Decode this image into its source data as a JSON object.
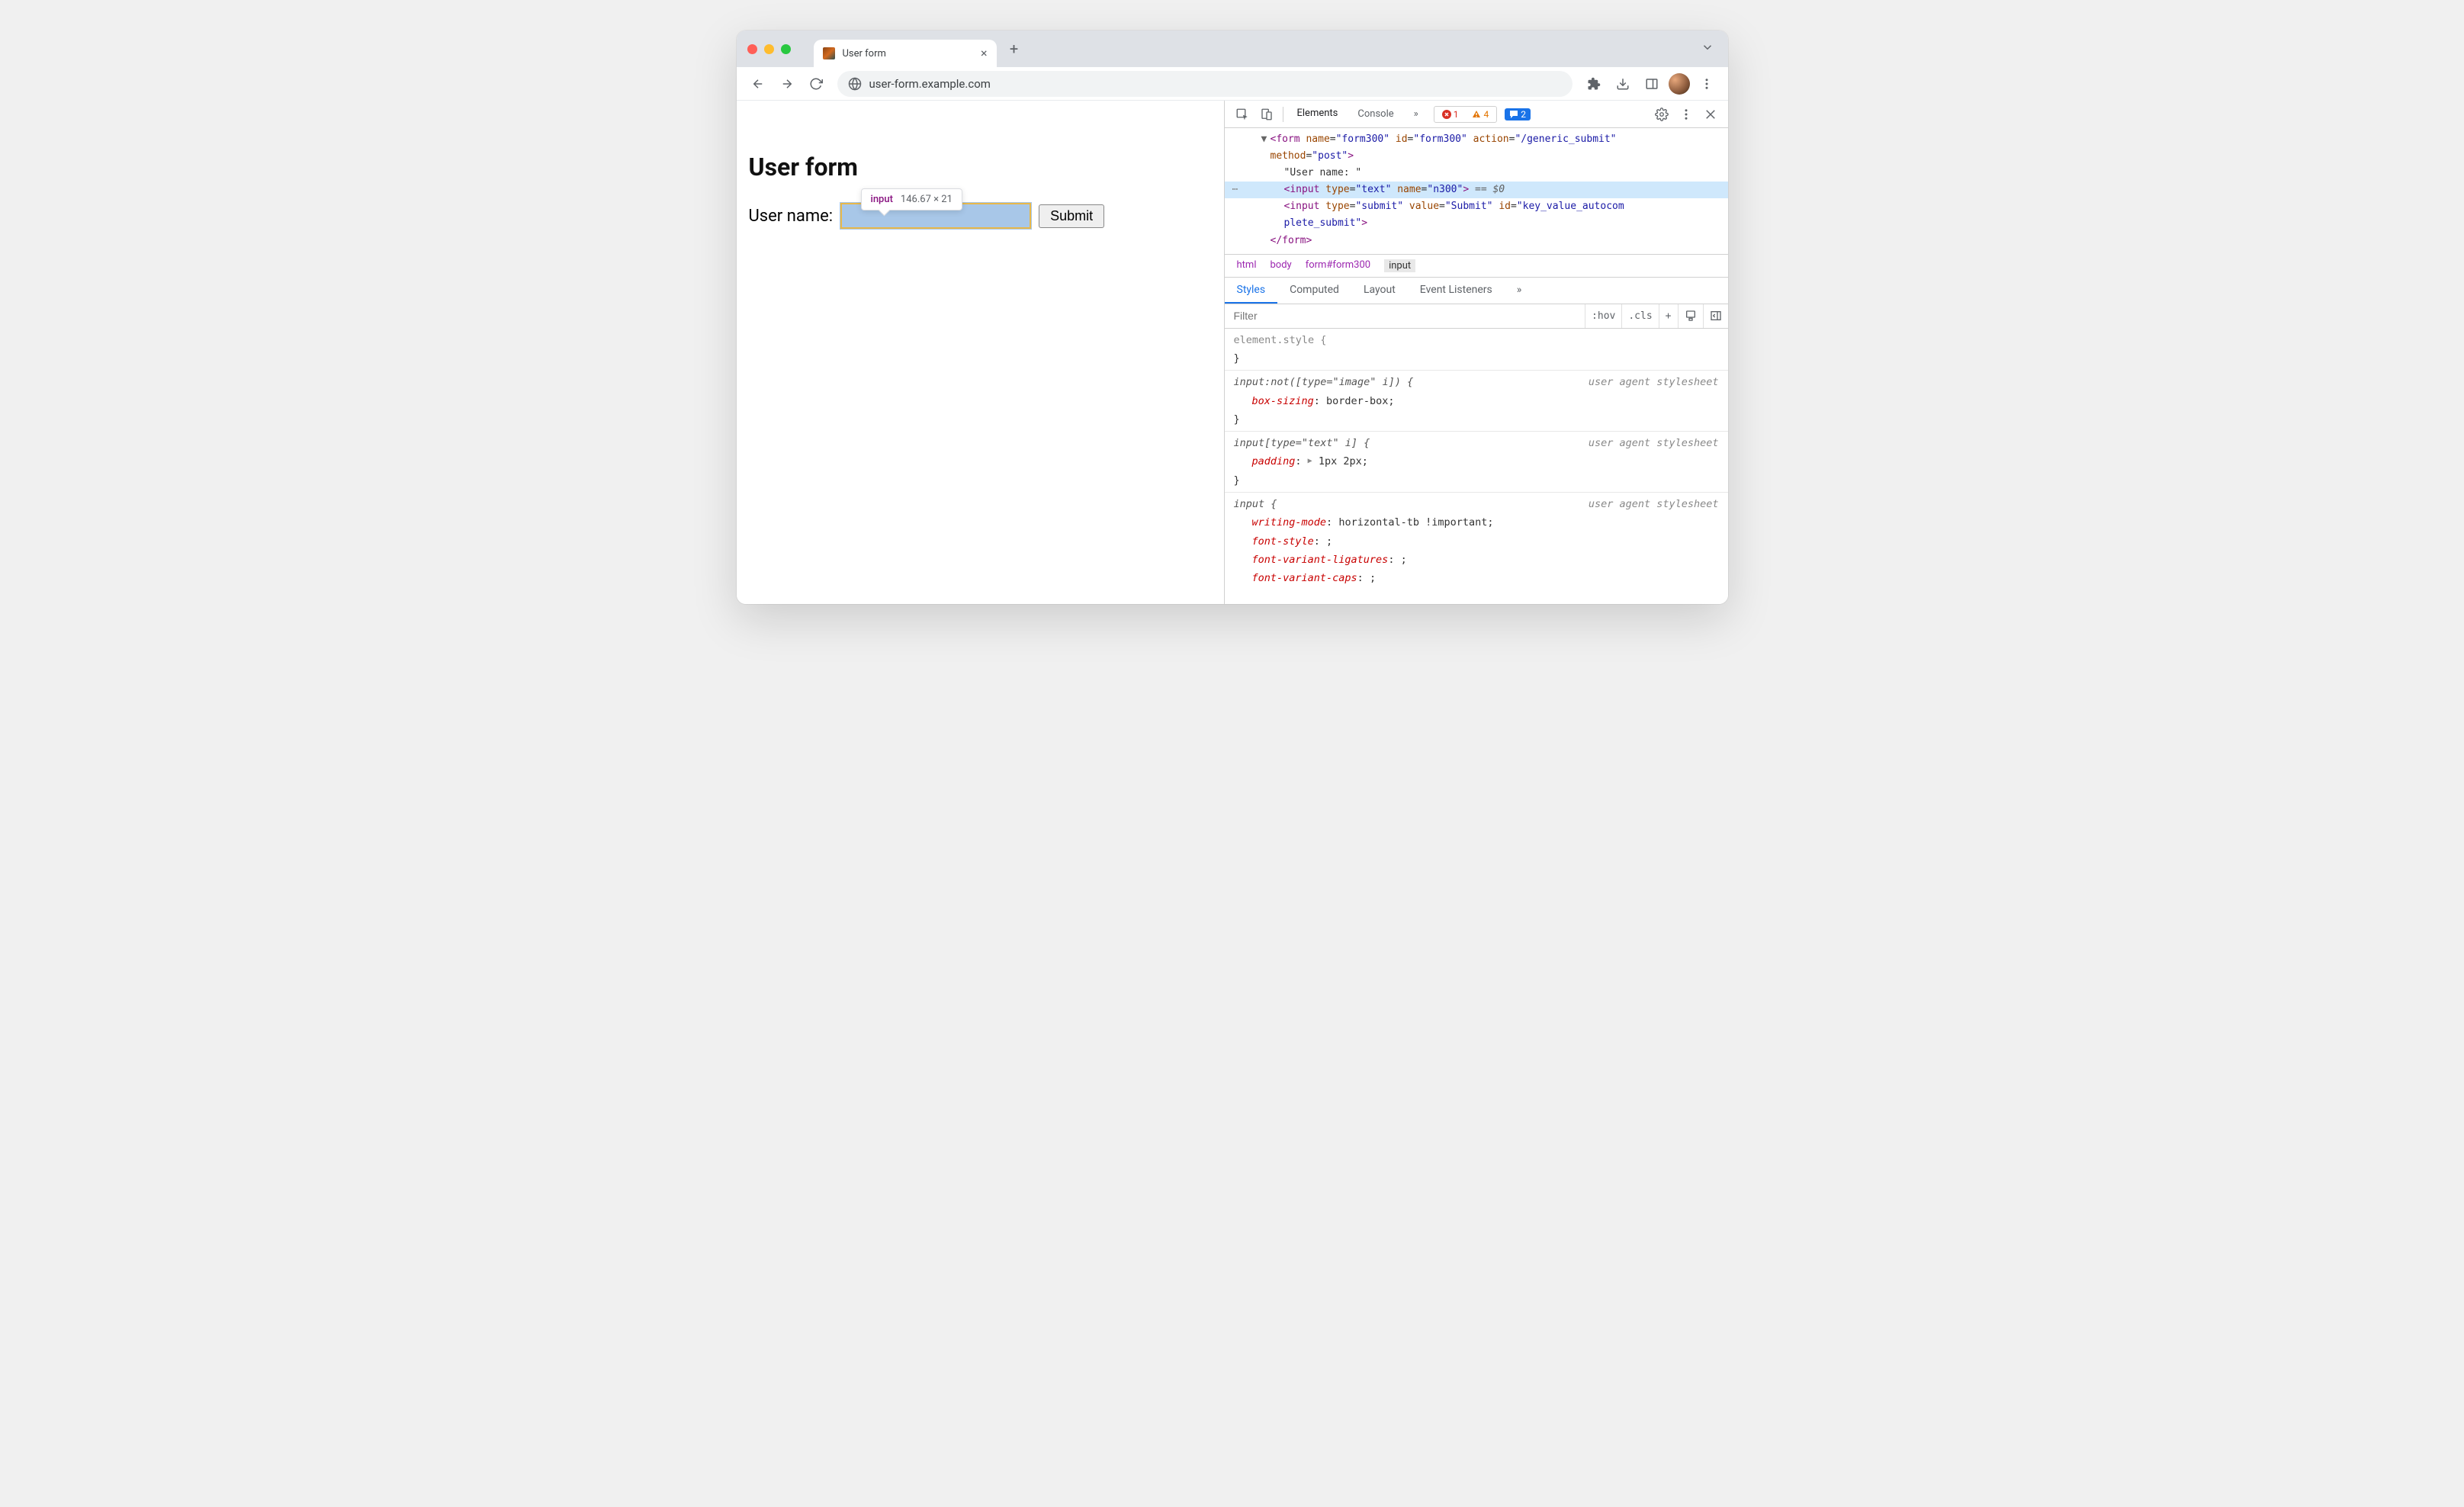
{
  "tab": {
    "title": "User form"
  },
  "url": "user-form.example.com",
  "page": {
    "heading": "User form",
    "label": "User name: ",
    "submit": "Submit"
  },
  "tooltip": {
    "element": "input",
    "dimensions": "146.67 × 21"
  },
  "devtools": {
    "tabs": {
      "elements": "Elements",
      "console": "Console",
      "more": "»"
    },
    "counts": {
      "errors": "1",
      "warnings": "4",
      "info": "2"
    },
    "dom": {
      "form_open_1": "<form name=\"form300\" id=\"form300\" action=\"/generic_submit\"",
      "form_open_2": "method=\"post\">",
      "text_node": "\"User name: \"",
      "input_sel": "<input type=\"text\" name=\"n300\">",
      "eq0": " == $0",
      "submit_1": "<input type=\"submit\" value=\"Submit\" id=\"key_value_autocom",
      "submit_2": "plete_submit\">",
      "form_close": "</form>"
    },
    "breadcrumb": [
      "html",
      "body",
      "form#form300",
      "input"
    ],
    "styles_tabs": {
      "styles": "Styles",
      "computed": "Computed",
      "layout": "Layout",
      "events": "Event Listeners",
      "more": "»"
    },
    "filter_placeholder": "Filter",
    "toolbar": {
      "hov": ":hov",
      "cls": ".cls",
      "plus": "+"
    },
    "rules": {
      "r0": {
        "selector": "element.style {",
        "close": "}"
      },
      "r1": {
        "selector": "input:not([type=\"image\" i]) {",
        "origin": "user agent stylesheet",
        "p1": "box-sizing",
        "v1": "border-box;",
        "close": "}"
      },
      "r2": {
        "selector": "input[type=\"text\" i] {",
        "origin": "user agent stylesheet",
        "p1": "padding",
        "v1": "1px 2px;",
        "close": "}"
      },
      "r3": {
        "selector": "input {",
        "origin": "user agent stylesheet",
        "p1": "writing-mode",
        "v1": "horizontal-tb !important;",
        "p2": "font-style",
        "v2": ";",
        "p3": "font-variant-ligatures",
        "v3": ";",
        "p4": "font-variant-caps",
        "v4": ";"
      }
    }
  }
}
